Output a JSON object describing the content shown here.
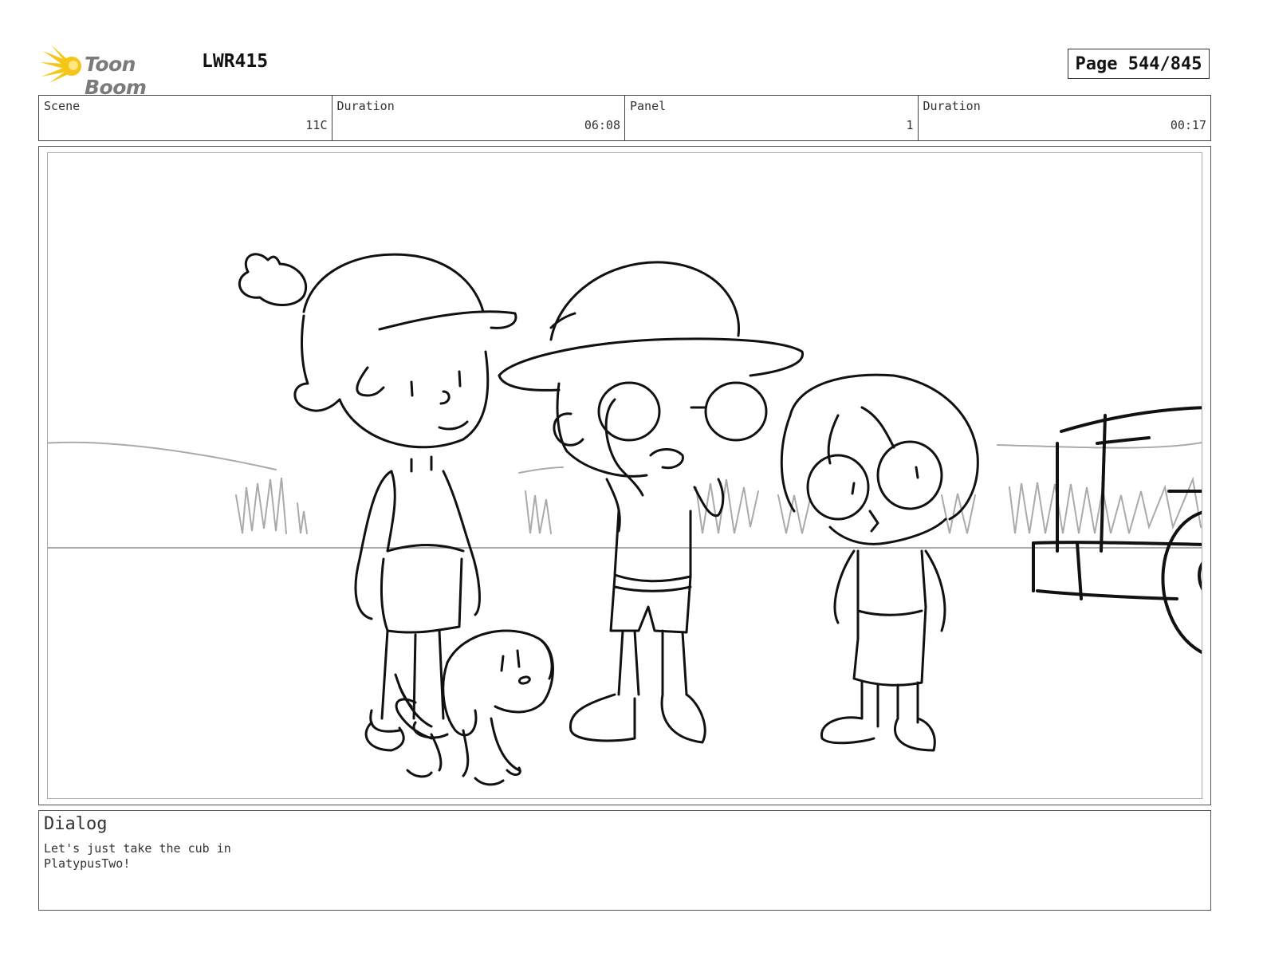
{
  "header": {
    "brand": "Toon Boom",
    "project": "LWR415",
    "page": "Page 544/845"
  },
  "info": {
    "scene_label": "Scene",
    "scene_value": "11C",
    "scene_duration_label": "Duration",
    "scene_duration_value": "06:08",
    "panel_label": "Panel",
    "panel_value": "1",
    "panel_duration_label": "Duration",
    "panel_duration_value": "00:17"
  },
  "dialog": {
    "title": "Dialog",
    "text": "Let's just take the cub in\nPlatypusTwo!"
  },
  "colors": {
    "logo_yellow": "#f5c518",
    "logo_text": "#7b7b7b"
  }
}
